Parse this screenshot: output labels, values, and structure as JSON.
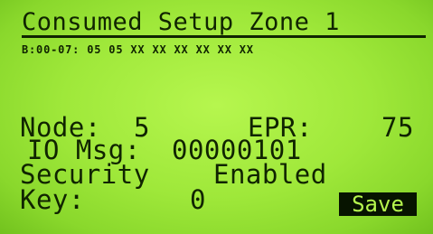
{
  "screen": {
    "title": "Consumed Setup Zone 1",
    "bytes_line": "B:00-07: 05 05 XX XX XX XX XX XX"
  },
  "fields": {
    "node_label": "Node:",
    "node_value": "5",
    "epr_label": "EPR:",
    "epr_value": "75",
    "io_msg_label": "IO Msg:",
    "io_msg_value": "00000101",
    "security_label": "Security",
    "security_value": "Enabled",
    "key_label": "Key:",
    "key_value": "0"
  },
  "actions": {
    "save_label": "Save"
  },
  "colors": {
    "lcd_background": "#9fe83a",
    "lcd_text": "#102400",
    "highlight_background": "#071400"
  }
}
